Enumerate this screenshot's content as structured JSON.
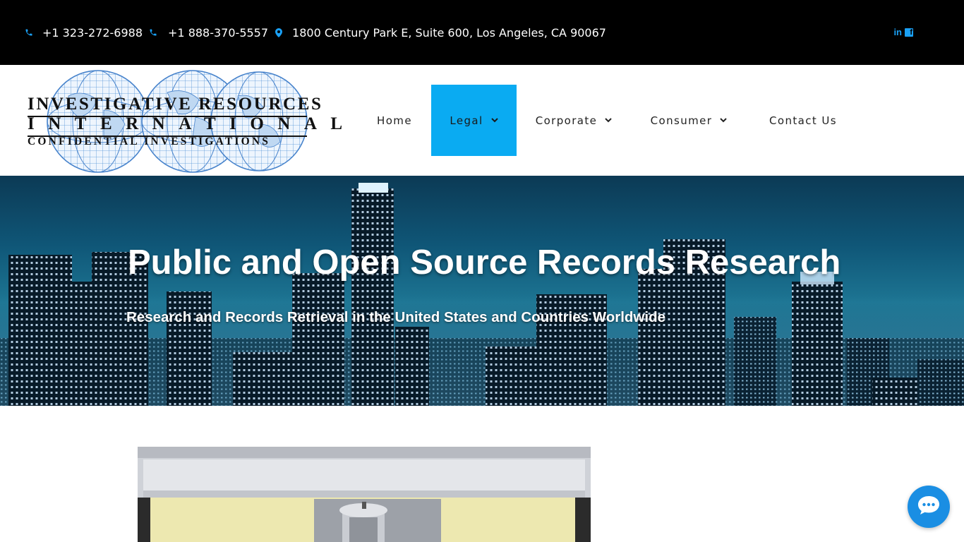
{
  "topbar": {
    "phone1": "+1 323-272-6988",
    "phone2": "+1 888-370-5557",
    "address": "1800 Century Park E, Suite 600, Los Angeles, CA 90067",
    "phone_icon": "phone-icon",
    "location_icon": "map-marker-icon",
    "social": {
      "linkedin_label": "in",
      "facebook_label": "f"
    },
    "accent_color": "#1aa0f5"
  },
  "logo": {
    "line1": "Investigative Resources",
    "line2": "International",
    "line3": "Confidential Investigations"
  },
  "nav": {
    "active_color": "#0aabf2",
    "items": [
      {
        "label": "Home"
      },
      {
        "label": "Legal",
        "has_dropdown": true,
        "active": true
      },
      {
        "label": "Corporate",
        "has_dropdown": true
      },
      {
        "label": "Consumer",
        "has_dropdown": true
      },
      {
        "label": "Contact Us"
      }
    ]
  },
  "hero": {
    "title": "Public and Open Source Records Research",
    "subtitle": "Research and Records Retrieval in the United States and Countries Worldwide"
  },
  "chat": {
    "icon": "chat-bubble-icon",
    "color": "#1a8ee3"
  }
}
